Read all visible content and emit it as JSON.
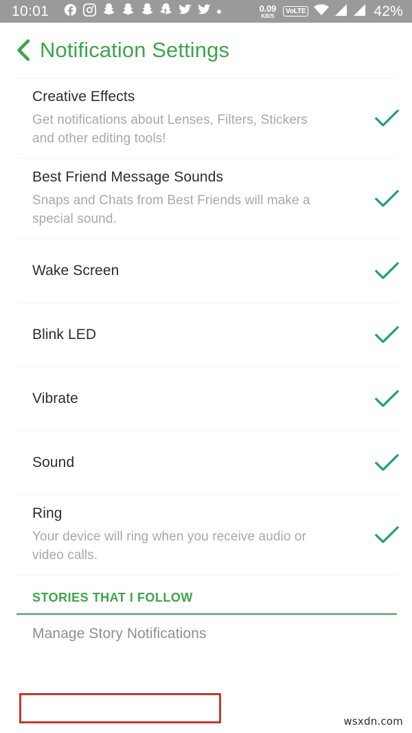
{
  "status_bar": {
    "clock": "10:01",
    "left_icons": [
      {
        "name": "facebook-icon",
        "glyph": "f"
      },
      {
        "name": "instagram-icon",
        "glyph": "▢"
      },
      {
        "name": "snapchat-icon-1",
        "glyph": "●"
      },
      {
        "name": "snapchat-icon-2",
        "glyph": "●"
      },
      {
        "name": "snapchat-icon-3",
        "glyph": "●"
      },
      {
        "name": "snapchat-ghost-icon",
        "glyph": "●"
      },
      {
        "name": "twitter-icon-1",
        "glyph": "●"
      },
      {
        "name": "twitter-icon-2",
        "glyph": "●"
      },
      {
        "name": "more-notifications-dot",
        "glyph": "·"
      }
    ],
    "network_speed_value": "0.09",
    "network_speed_unit": "KB/S",
    "volte_label": "VoLTE",
    "wifi_icon": "wifi-icon",
    "signal_icon_1": "signal-bars-icon-sim1",
    "signal_icon_2": "signal-bars-icon-sim2",
    "battery": "42%",
    "background_color": "#9a9a9a"
  },
  "header": {
    "back_icon": "chevron-left-icon",
    "title": "Notification Settings",
    "accent_color": "#3aa64a"
  },
  "settings": {
    "check_color": "#1a9e7a",
    "rows": [
      {
        "name": "creative-effects",
        "title": "Creative Effects",
        "subtitle": "Get notifications about Lenses, Filters, Stickers and other editing tools!",
        "checked": true
      },
      {
        "name": "best-friend-message-sounds",
        "title": "Best Friend Message Sounds",
        "subtitle": "Snaps and Chats from Best Friends will make a special sound.",
        "checked": true
      },
      {
        "name": "wake-screen",
        "title": "Wake Screen",
        "subtitle": "",
        "checked": true
      },
      {
        "name": "blink-led",
        "title": "Blink LED",
        "subtitle": "",
        "checked": true
      },
      {
        "name": "vibrate",
        "title": "Vibrate",
        "subtitle": "",
        "checked": true
      },
      {
        "name": "sound",
        "title": "Sound",
        "subtitle": "",
        "checked": true
      },
      {
        "name": "ring",
        "title": "Ring",
        "subtitle": "Your device will ring when you receive audio or video calls.",
        "checked": true
      }
    ]
  },
  "stories_section": {
    "header_label": "STORIES THAT I FOLLOW",
    "header_color": "#3aa64a",
    "divider_color": "#3f9e52",
    "manage_label": "Manage Story Notifications",
    "highlight_color": "#c0392b"
  },
  "watermark": {
    "text": "wsxdn.com"
  }
}
